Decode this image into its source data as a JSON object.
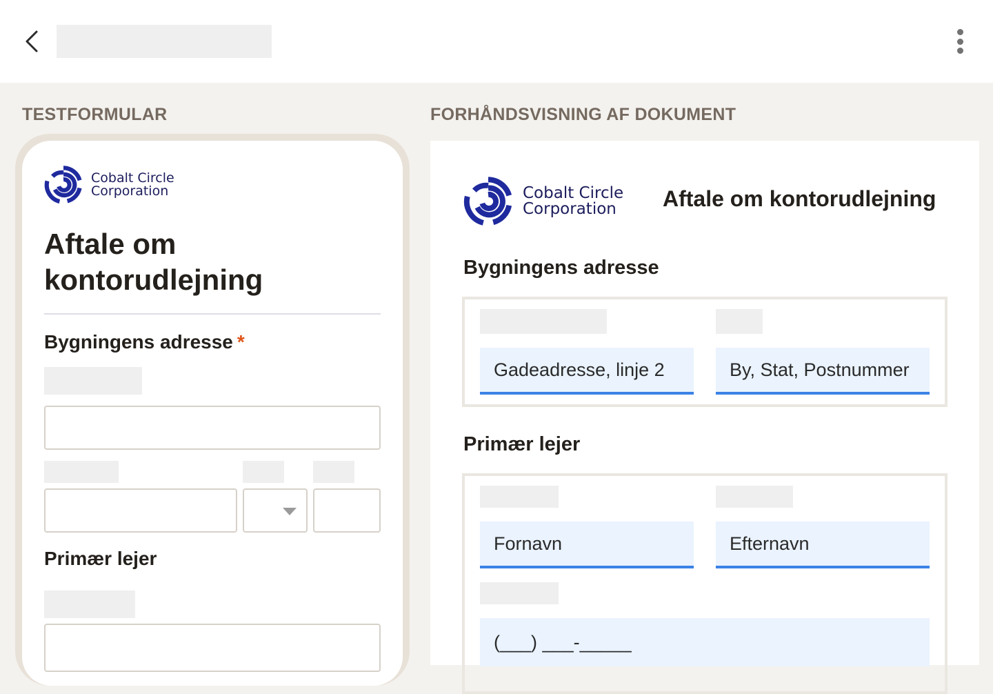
{
  "header": {
    "back_icon": "chevron-left-icon",
    "more_icon": "more-vertical-icon"
  },
  "left_panel": {
    "label": "TESTFORMULAR",
    "logo": {
      "line1": "Cobalt Circle",
      "line2": "Corporation",
      "color": "#1f2a9e"
    },
    "title": "Aftale om kontorudlejning",
    "building_address": {
      "label": "Bygningens adresse",
      "required_mark": "*"
    },
    "primary_tenant": {
      "label": "Primær lejer"
    }
  },
  "right_panel": {
    "label": "FORHÅNDSVISNING AF DOKUMENT",
    "logo": {
      "line1": "Cobalt Circle",
      "line2": "Corporation"
    },
    "title": "Aftale om kontorudlejning",
    "building_address": {
      "label": "Bygningens adresse",
      "street_line2": "Gadeadresse, linje 2",
      "city_state_zip": "By, Stat, Postnummer"
    },
    "primary_tenant": {
      "label": "Primær lejer",
      "first_name": "Fornavn",
      "last_name": "Efternavn",
      "phone": "(___) ___-_____"
    }
  },
  "colors": {
    "accent_blue": "#3b82e6",
    "field_bg": "#eaf3fe",
    "required": "#e0561b",
    "brand": "#1f2a9e"
  }
}
